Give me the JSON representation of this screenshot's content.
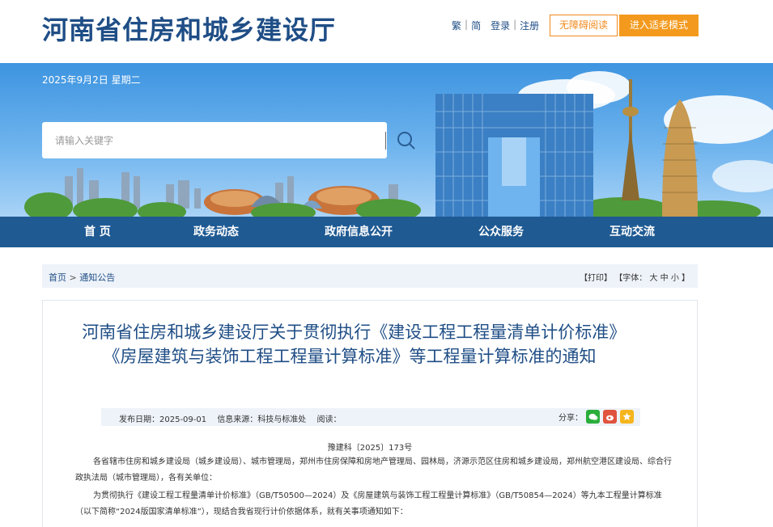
{
  "header": {
    "site_title": "河南省住房和城乡建设厅",
    "links": {
      "traditional": "繁",
      "simplified": "简",
      "login": "登录",
      "register": "注册"
    },
    "accessible_btn": "无障碍阅读",
    "elder_btn": "进入适老模式",
    "accent_color": "#f39a1e",
    "brand_color": "#1f4e86"
  },
  "banner": {
    "date": "2025年9月2日 星期二",
    "search": {
      "placeholder": "请输入关键字",
      "value": "",
      "icon": "search-icon"
    }
  },
  "nav": {
    "items": [
      "首  页",
      "政务动态",
      "政府信息公开",
      "公众服务",
      "互动交流"
    ]
  },
  "breadcrumb": {
    "home": "首页",
    "separator": ">",
    "current": "通知公告"
  },
  "tools": {
    "print": "【打印】",
    "font_label": "【字体：",
    "large": "大",
    "medium": "中",
    "small": "小",
    "close": "】"
  },
  "article": {
    "title": "河南省住房和城乡建设厅关于贯彻执行《建设工程工程量清单计价标准》《房屋建筑与装饰工程工程量计算标准》等工程量计算标准的通知",
    "meta": {
      "date": "发布日期：2025-09-01",
      "source": "信息来源：科技与标准处",
      "reads": "阅读："
    },
    "share_label": "分享：",
    "doc_no": "豫建科〔2025〕173号",
    "para1": "各省辖市住房和城乡建设局（城乡建设局）、城市管理局，郑州市住房保障和房地产管理局、园林局，济源示范区住房和城乡建设局，郑州航空港区建设局、综合行政执法局（城市管理局），各有关单位：",
    "para2": "为贯彻执行《建设工程工程量清单计价标准》（GB/T50500—2024）及《房屋建筑与装饰工程工程量计算标准》（GB/T50854—2024）等九本工程量计算标准（以下简称“2024版国家清单标准”），现结合我省现行计价依据体系，就有关事项通知如下："
  }
}
